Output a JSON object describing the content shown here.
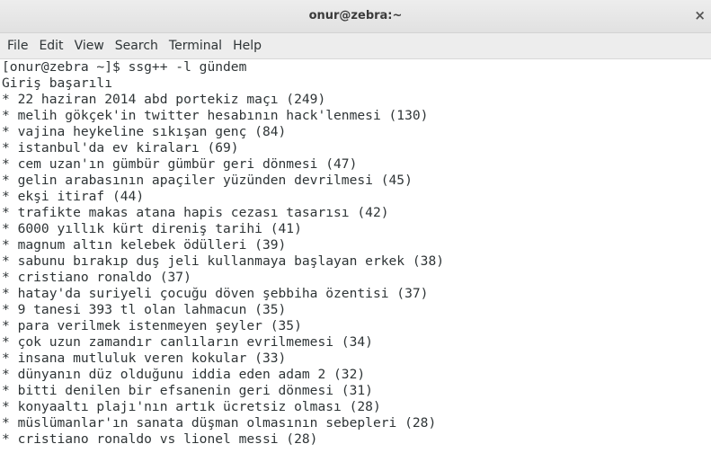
{
  "window": {
    "title": "onur@zebra:~",
    "close_glyph": "×"
  },
  "menu": [
    "File",
    "Edit",
    "View",
    "Search",
    "Terminal",
    "Help"
  ],
  "terminal": {
    "lines": [
      "[onur@zebra ~]$ ssg++ -l gündem",
      "Giriş başarılı",
      "* 22 haziran 2014 abd portekiz maçı (249)",
      "* melih gökçek'in twitter hesabının hack'lenmesi (130)",
      "* vajina heykeline sıkışan genç (84)",
      "* istanbul'da ev kiraları (69)",
      "* cem uzan'ın gümbür gümbür geri dönmesi (47)",
      "* gelin arabasının apaçiler yüzünden devrilmesi (45)",
      "* ekşi itiraf (44)",
      "* trafikte makas atana hapis cezası tasarısı (42)",
      "* 6000 yıllık kürt direniş tarihi (41)",
      "* magnum altın kelebek ödülleri (39)",
      "* sabunu bırakıp duş jeli kullanmaya başlayan erkek (38)",
      "* cristiano ronaldo (37)",
      "* hatay'da suriyeli çocuğu döven şebbiha özentisi (37)",
      "* 9 tanesi 393 tl olan lahmacun (35)",
      "* para verilmek istenmeyen şeyler (35)",
      "* çok uzun zamandır canlıların evrilmemesi (34)",
      "* insana mutluluk veren kokular (33)",
      "* dünyanın düz olduğunu iddia eden adam 2 (32)",
      "* bitti denilen bir efsanenin geri dönmesi (31)",
      "* konyaaltı plajı'nın artık ücretsiz olması (28)",
      "* müslümanlar'ın sanata düşman olmasının sebepleri (28)",
      "* cristiano ronaldo vs lionel messi (28)"
    ]
  }
}
